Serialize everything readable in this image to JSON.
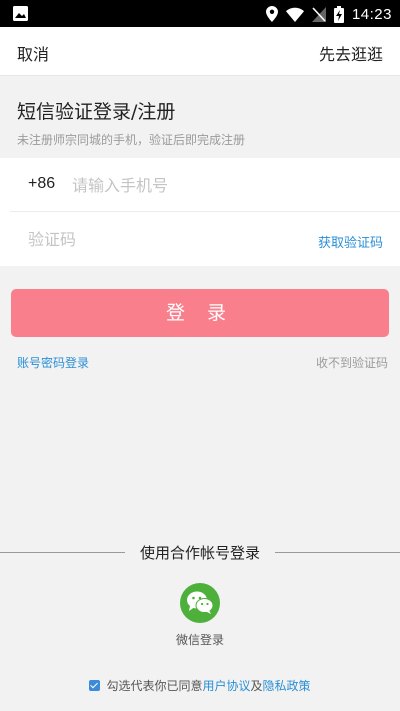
{
  "status_bar": {
    "time": "14:23",
    "icons": [
      "image-icon",
      "location-icon",
      "wifi-icon",
      "signal-off-icon",
      "battery-charging-icon"
    ]
  },
  "topbar": {
    "cancel_label": "取消",
    "browse_label": "先去逛逛"
  },
  "header": {
    "title": "短信验证登录/注册",
    "subtitle": "未注册师宗同城的手机，验证后即完成注册"
  },
  "form": {
    "country_code": "+86",
    "phone_placeholder": "请输入手机号",
    "phone_value": "",
    "code_placeholder": "验证码",
    "code_value": "",
    "get_code_label": "获取验证码"
  },
  "login_button_label": "登 录",
  "links": {
    "account_login": "账号密码登录",
    "no_code": "收不到验证码"
  },
  "partner": {
    "title": "使用合作帐号登录",
    "wechat_label": "微信登录"
  },
  "agreement": {
    "checked": true,
    "prefix": "勾选代表你已同意",
    "user_agreement": "用户协议",
    "and": "及",
    "privacy_policy": "隐私政策"
  },
  "colors": {
    "accent_blue": "#2a8fd6",
    "login_button": "#f97f8d",
    "wechat_green": "#4cb03a",
    "background": "#f2f2f2"
  }
}
